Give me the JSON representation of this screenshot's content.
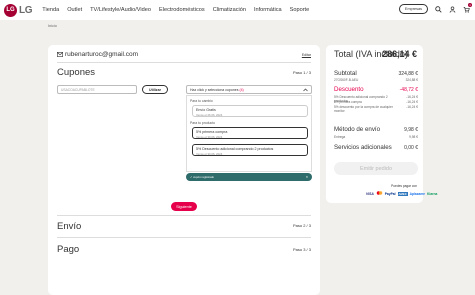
{
  "header": {
    "logo_circle": "LG",
    "logo_text": "LG",
    "nav": [
      "Tienda",
      "Outlet",
      "TV/Lifestyle/Audio/Video",
      "Electrodomésticos",
      "Climatización",
      "Informática",
      "Soporte"
    ],
    "empresas": "Empresas",
    "cart_count": "1"
  },
  "breadcrumb": "Inicio",
  "checkout": {
    "email": "rubenarturoc@gmail.com",
    "edit": "Editar",
    "coupons_title": "Cupones",
    "coupons_step": "Paso 1 / 3",
    "coupon_placeholder": "USACOACUPABLOTE",
    "use_button": "Utilizar",
    "dropdown_label": "Haz click y selecciona cupones",
    "dropdown_count": "(4)",
    "group_cart": "Para tu cambio",
    "group_product": "Para tu producto",
    "options": [
      {
        "name": "Envío Gratis",
        "date": "Vence el 26.06. 2024",
        "selected": false
      },
      {
        "name": "5% primera compra",
        "date": "Vence el 30.06. 2024",
        "selected": true
      },
      {
        "name": "5% Descuento adicional comprando 2 productos",
        "date": "Vence el 30.06. 2024",
        "selected": true
      }
    ],
    "toast": "cupón registrado",
    "next_button": "Siguiente",
    "shipping_title": "Envío",
    "shipping_step": "Paso 2 / 3",
    "payment_title": "Pago",
    "payment_step": "Paso 3 / 3"
  },
  "summary": {
    "title": "Total (IVA incluido)",
    "total": "286,14 €",
    "subtotal_label": "Subtotal",
    "subtotal_value": "324,88 €",
    "product_label": "27GS60F-B.AEU",
    "product_value": "324,88 €",
    "discount_label": "Descuento",
    "discount_value": "-48,72 €",
    "discounts": [
      {
        "label": "5% Descuento adicional comprando 2 productos",
        "value": "-16,24 €"
      },
      {
        "label": "5% primera compra",
        "value": "-16,24 €"
      },
      {
        "label": "5% descuento por la compra de cualquier monitor",
        "value": "-16,24 €"
      }
    ],
    "shipping_label": "Método de envío",
    "shipping_value": "9,98 €",
    "delivery_label": "Entrega",
    "delivery_value": "9,98 €",
    "extra_label": "Servicios adicionales",
    "extra_value": "0,00 €",
    "emit_button": "Emitir pedido",
    "payment_methods_label": "Puedes pagar con",
    "payment_logos": [
      "VISA",
      "MC",
      "PayPal",
      "AMEX",
      "Aplazame",
      "Klarna"
    ]
  }
}
